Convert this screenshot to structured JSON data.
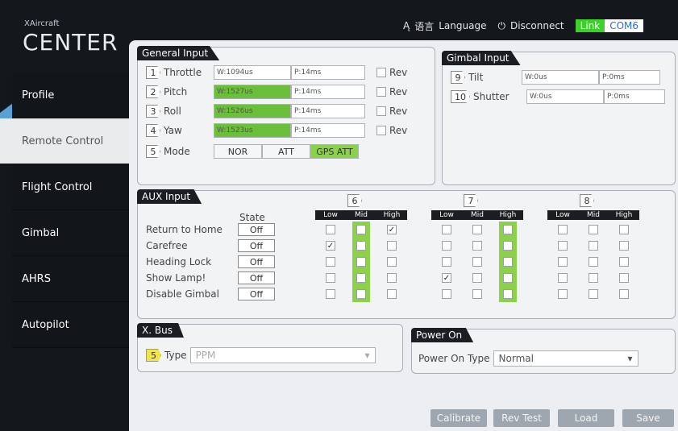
{
  "header": {
    "brand_small": "XAircraft",
    "brand_big": "CENTER",
    "language_glyphs": "语言",
    "language": "Language",
    "disconnect": "Disconnect",
    "link": "Link",
    "com": "COM6"
  },
  "sidebar": {
    "items": [
      {
        "label": "Profile"
      },
      {
        "label": "Remote Control"
      },
      {
        "label": "Flight Control"
      },
      {
        "label": "Gimbal"
      },
      {
        "label": "AHRS"
      },
      {
        "label": "Autopilot"
      }
    ]
  },
  "general": {
    "title": "General Input",
    "rev_label": "Rev",
    "channels": [
      {
        "num": "1",
        "label": "Throttle",
        "w": "W:1094us",
        "p": "P:14ms",
        "active": false
      },
      {
        "num": "2",
        "label": "Pitch",
        "w": "W:1527us",
        "p": "P:14ms",
        "active": true
      },
      {
        "num": "3",
        "label": "Roll",
        "w": "W:1526us",
        "p": "P:14ms",
        "active": true
      },
      {
        "num": "4",
        "label": "Yaw",
        "w": "W:1523us",
        "p": "P:14ms",
        "active": true
      }
    ],
    "mode": {
      "num": "5",
      "label": "Mode",
      "options": [
        "NOR",
        "ATT",
        "GPS ATT"
      ]
    }
  },
  "gimbal_input": {
    "title": "Gimbal Input",
    "channels": [
      {
        "num": "9",
        "label": "Tilt",
        "w": "W:0us",
        "p": "P:0ms"
      },
      {
        "num": "10",
        "label": "Shutter",
        "w": "W:0us",
        "p": "P:0ms"
      }
    ]
  },
  "aux": {
    "title": "AUX Input",
    "state_label": "State",
    "rows": [
      {
        "label": "Return to Home",
        "state": "Off"
      },
      {
        "label": "Carefree",
        "state": "Off"
      },
      {
        "label": "Heading Lock",
        "state": "Off"
      },
      {
        "label": "Show Lamp!",
        "state": "Off"
      },
      {
        "label": "Disable Gimbal",
        "state": "Off"
      }
    ],
    "groups": [
      {
        "num": "6",
        "headers": [
          "Low",
          "Mid",
          "High"
        ]
      },
      {
        "num": "7",
        "headers": [
          "Low",
          "Mid",
          "High"
        ]
      },
      {
        "num": "8",
        "headers": [
          "Low",
          "Mid",
          "High"
        ]
      }
    ]
  },
  "xbus": {
    "title": "X. Bus",
    "num": "5",
    "type_label": "Type",
    "type_value": "PPM"
  },
  "power": {
    "title": "Power On",
    "type_label": "Power On Type",
    "type_value": "Normal"
  },
  "footer": {
    "calibrate": "Calibrate",
    "rev_test": "Rev Test",
    "load": "Load",
    "save": "Save"
  }
}
